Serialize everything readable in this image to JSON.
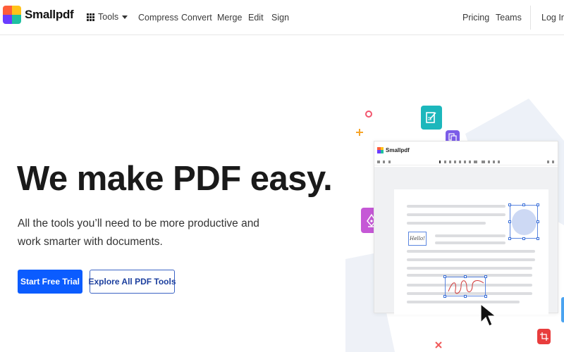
{
  "header": {
    "brand": "Smallpdf",
    "tools_label": "Tools",
    "nav": [
      "Compress",
      "Convert",
      "Merge",
      "Edit",
      "Sign"
    ],
    "pricing": "Pricing",
    "teams": "Teams",
    "login": "Log In"
  },
  "hero": {
    "title": "We make PDF easy.",
    "subtitle": "All the tools you’ll need to be more productive and work smarter with documents.",
    "primary_cta": "Start Free Trial",
    "secondary_cta": "Explore All PDF Tools"
  },
  "illustration": {
    "app_brand": "Smallpdf",
    "hello_text": "Hello!"
  },
  "colors": {
    "primary": "#0b5cff",
    "secondary_border": "#3b63c4",
    "logo": [
      "#ff5e3a",
      "#ffc21a",
      "#6a3cff",
      "#1fc0a0"
    ]
  },
  "icons": {
    "tools": "grid-icon",
    "tools_caret": "chevron-down-icon",
    "float_1": "edit-document-icon",
    "float_2": "copy-document-icon",
    "float_3": "pen-tool-icon",
    "float_4": "image-icon",
    "float_5": "crop-icon",
    "cursor": "mouse-pointer-icon"
  }
}
